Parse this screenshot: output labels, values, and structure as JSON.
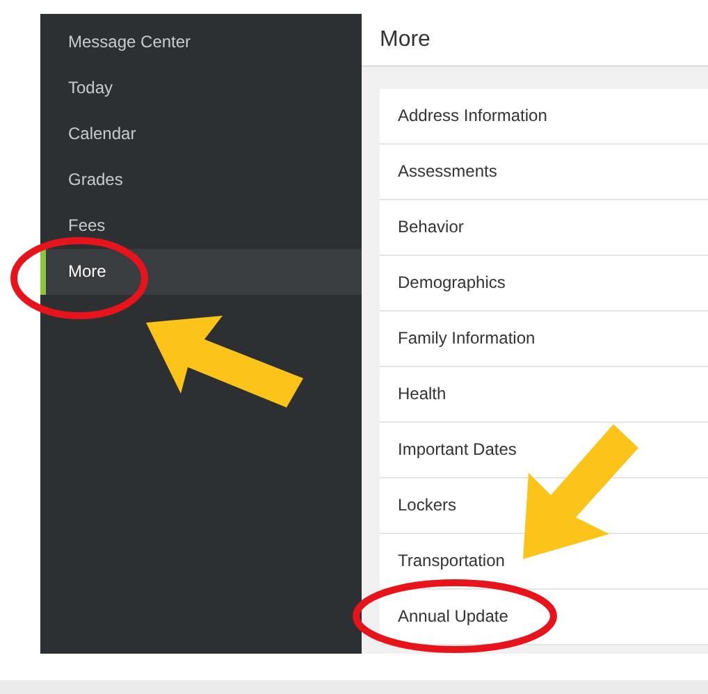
{
  "sidebar": {
    "items": [
      {
        "label": "Message Center",
        "selected": false
      },
      {
        "label": "Today",
        "selected": false
      },
      {
        "label": "Calendar",
        "selected": false
      },
      {
        "label": "Grades",
        "selected": false
      },
      {
        "label": "Fees",
        "selected": false
      },
      {
        "label": "More",
        "selected": true
      }
    ]
  },
  "page": {
    "title": "More",
    "items": [
      "Address Information",
      "Assessments",
      "Behavior",
      "Demographics",
      "Family Information",
      "Health",
      "Important Dates",
      "Lockers",
      "Transportation",
      "Annual Update"
    ]
  }
}
